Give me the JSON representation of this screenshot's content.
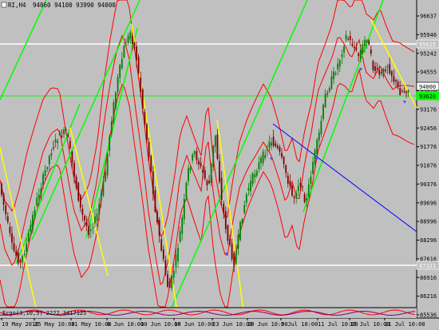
{
  "header": {
    "symbol": "RI,H4",
    "ohlc": "94060 94100 93990 94000"
  },
  "indicator_label": "Ergo(3,10,5) 2222 3417125",
  "price_axis": {
    "ticks": [
      "96637",
      "95946",
      "95242",
      "94555",
      "93870",
      "93176",
      "92456",
      "91776",
      "91076",
      "90376",
      "89696",
      "88996",
      "88296",
      "87616",
      "86916",
      "86216",
      "85536"
    ],
    "boxes": [
      {
        "label": "95625",
        "style": "white-line"
      },
      {
        "label": "94000",
        "style": "current"
      },
      {
        "label": "93620",
        "style": "green"
      },
      {
        "label": "87321",
        "style": "white-line"
      }
    ]
  },
  "time_axis": {
    "labels": [
      "19 May 2016",
      "25 May 10:00",
      "31 May 10:00",
      "6 Jun 10:00",
      "10 Jun 10:00",
      "16 Jun 10:00",
      "23 Jun 10:00",
      "29 Jun 10:00",
      "5 Jul 10:00",
      "11 Jul 10:00",
      "15 Jul 10:00",
      "21 Jul 10:00"
    ]
  },
  "colors": {
    "background": "#c0c0c0",
    "bull_candle": "#008000",
    "bear_candle": "#800000",
    "bands": "#ff0000",
    "trend_green": "#00ff00",
    "trend_yellow": "#ffff00",
    "trend_blue": "#0000ff",
    "horizontal_line": "#ffffff",
    "horizontal_green": "#00ff00"
  }
}
